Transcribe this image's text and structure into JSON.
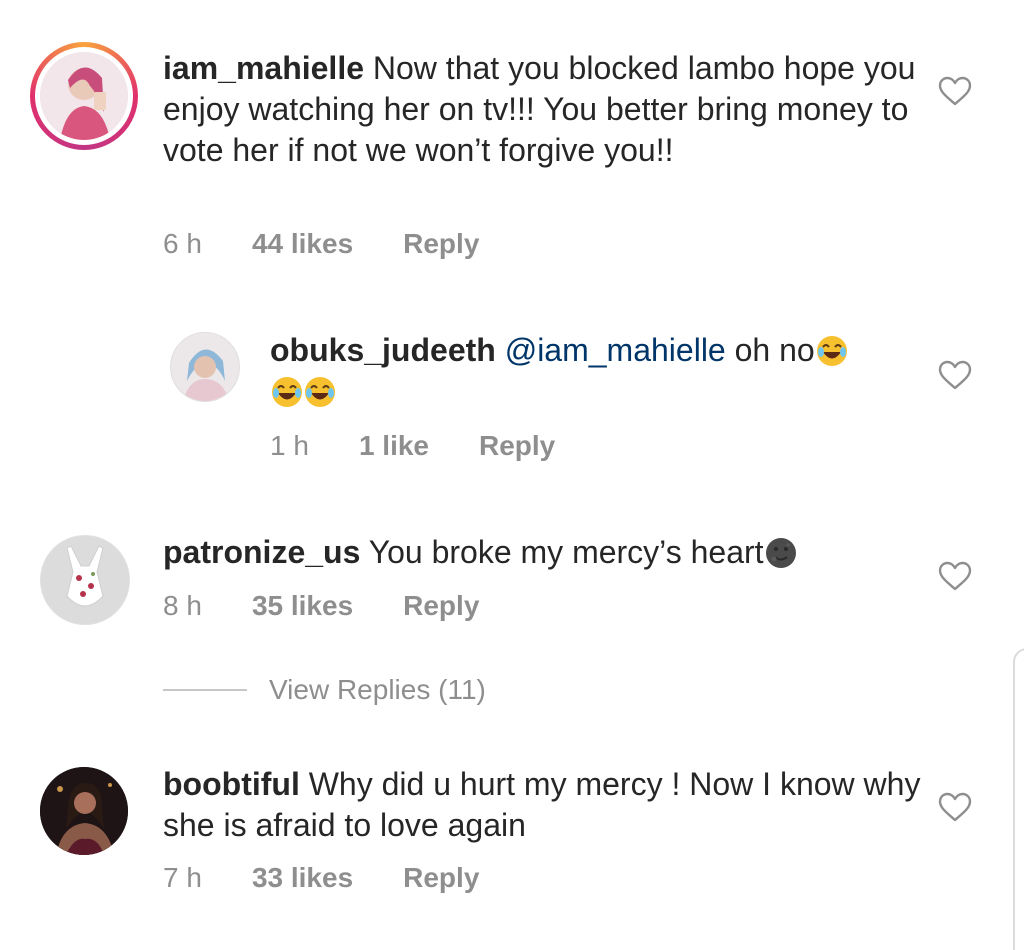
{
  "comments": [
    {
      "username": "iam_mahielle",
      "text": " Now that you blocked lambo hope you enjoy watching her on tv!!! You better bring money to vote her if not we won’t forgive you!!",
      "time": "6 h",
      "likes": "44 likes",
      "reply": "Reply"
    },
    {
      "username": "obuks_judeeth",
      "mention": "@iam_mahielle",
      "text": " oh no",
      "emojis": [
        "joy-emoji",
        "joy-emoji",
        "joy-emoji"
      ],
      "time": "1 h",
      "likes": "1 like",
      "reply": "Reply"
    },
    {
      "username": "patronize_us",
      "text": " You broke my mercy’s heart",
      "emojis": [
        "new-moon-face-emoji"
      ],
      "time": "8 h",
      "likes": "35 likes",
      "reply": "Reply"
    },
    {
      "username": "boobtiful",
      "text": " Why did u hurt my mercy ! Now I know why she is afraid to love again",
      "time": "7 h",
      "likes": "33 likes",
      "reply": "Reply"
    }
  ],
  "view_replies": "View Replies (11)",
  "icons": {
    "like": "heart-outline-icon"
  },
  "colors": {
    "text": "#262626",
    "meta": "#8e8e8e",
    "mention": "#003569"
  }
}
